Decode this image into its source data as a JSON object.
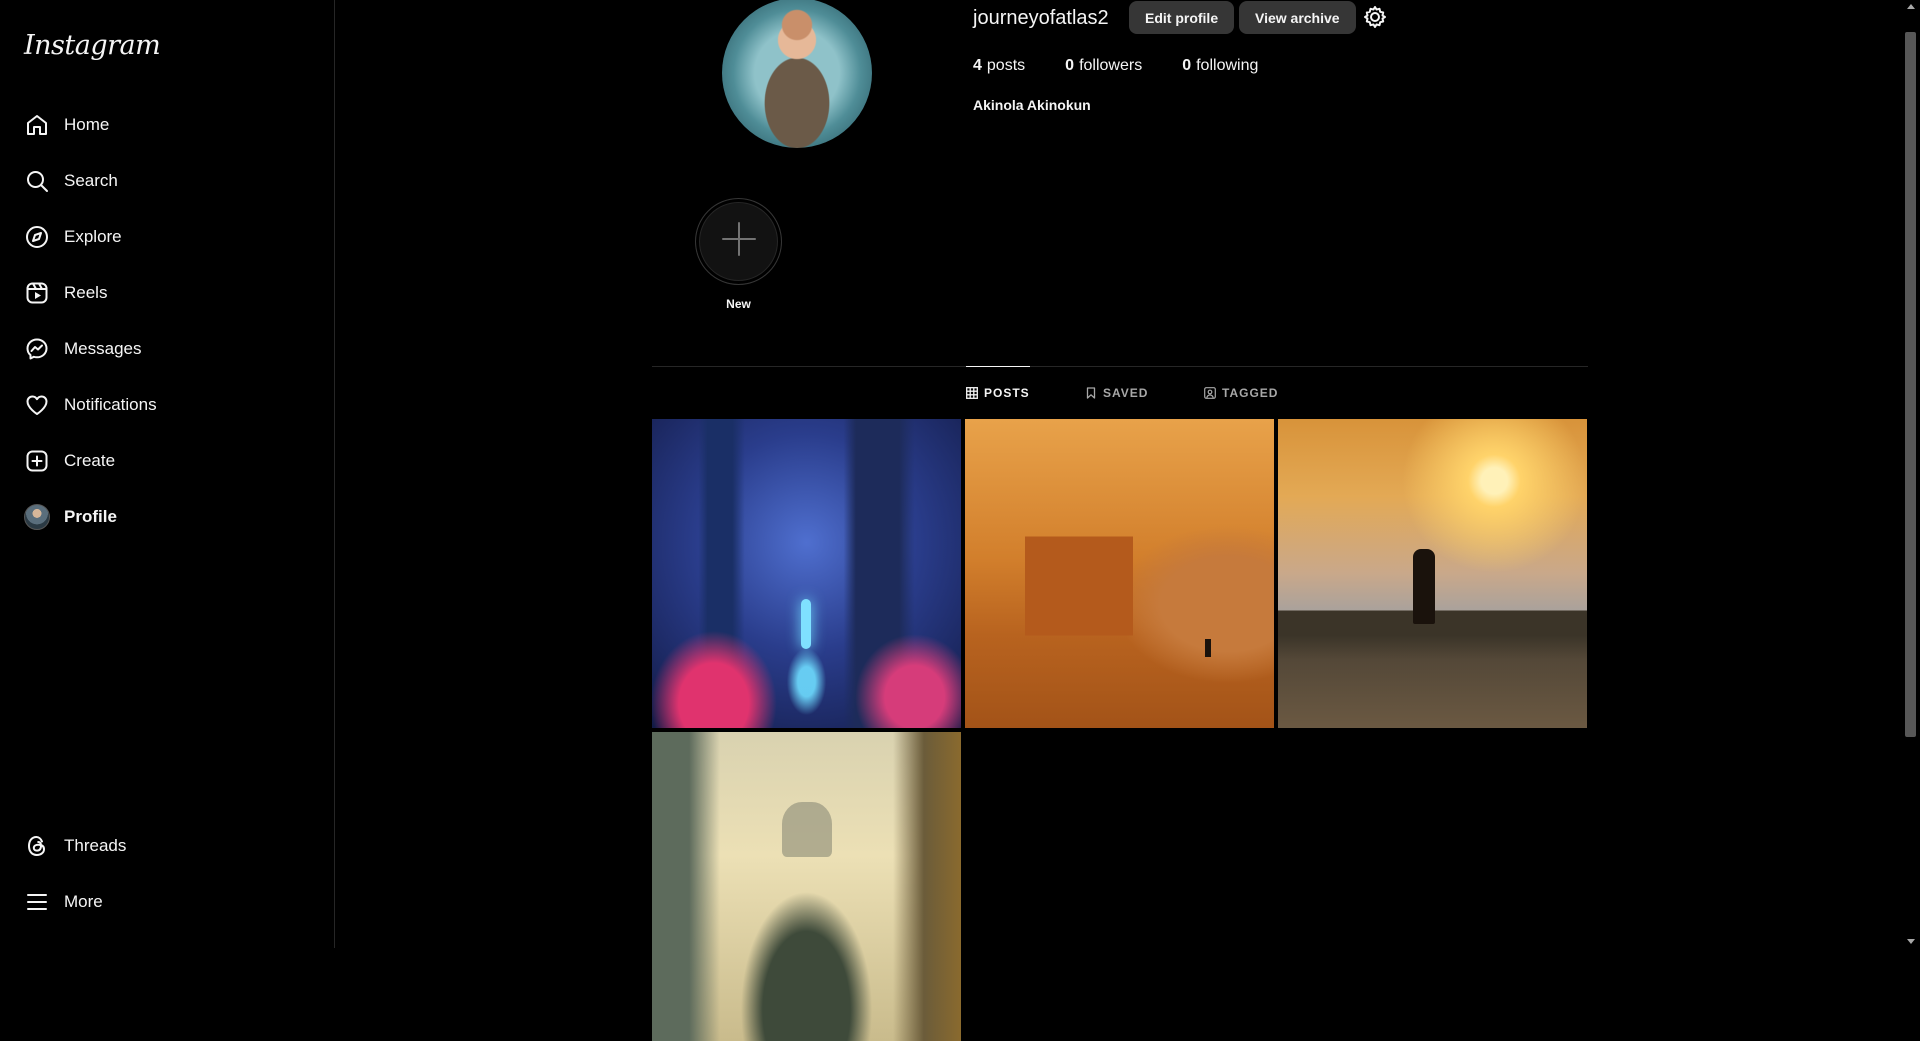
{
  "app": {
    "logo": "Instagram"
  },
  "sidebar": {
    "items": [
      {
        "label": "Home",
        "icon": "home-icon"
      },
      {
        "label": "Search",
        "icon": "search-icon"
      },
      {
        "label": "Explore",
        "icon": "compass-icon"
      },
      {
        "label": "Reels",
        "icon": "reels-icon"
      },
      {
        "label": "Messages",
        "icon": "messenger-icon"
      },
      {
        "label": "Notifications",
        "icon": "heart-icon"
      },
      {
        "label": "Create",
        "icon": "plus-square-icon"
      },
      {
        "label": "Profile",
        "icon": "avatar"
      }
    ],
    "bottom": [
      {
        "label": "Threads",
        "icon": "threads-icon"
      },
      {
        "label": "More",
        "icon": "hamburger-icon"
      }
    ]
  },
  "profile": {
    "username": "journeyofatlas2",
    "edit_label": "Edit profile",
    "archive_label": "View archive",
    "posts_count": "4",
    "posts_label": "posts",
    "followers_count": "0",
    "followers_label": "followers",
    "following_count": "0",
    "following_label": "following",
    "full_name": "Akinola Akinokun"
  },
  "highlights": {
    "new_label": "New"
  },
  "tabs": {
    "posts": "POSTS",
    "saved": "SAVED",
    "tagged": "TAGGED"
  },
  "colors": {
    "background": "#000000",
    "button": "#363636",
    "divider": "#262626",
    "muted_text": "#a8a8a8"
  }
}
